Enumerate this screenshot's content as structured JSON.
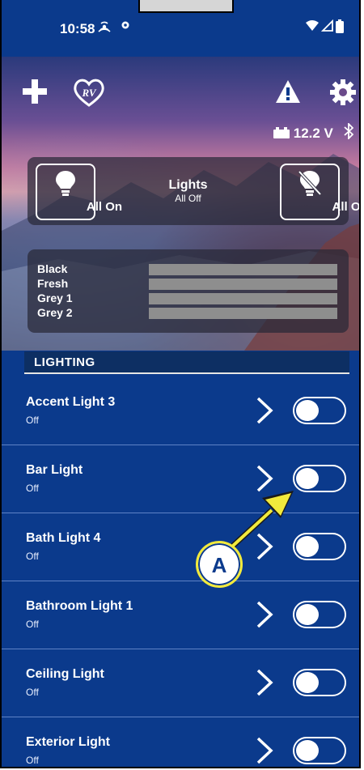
{
  "status_bar": {
    "time": "10:58",
    "icons": [
      "hotspot-icon",
      "settings-dot-icon",
      "wifi-icon",
      "signal-icon",
      "battery-icon"
    ]
  },
  "header": {
    "icons": [
      "plus-icon",
      "rv-heart-logo-icon",
      "warning-icon",
      "settings-gear-icon"
    ],
    "logo_text": "RV",
    "battery_voltage": "12.2 V"
  },
  "lights_panel": {
    "all_on_label": "All On",
    "title": "Lights",
    "subtitle": "All Off",
    "all_off_label": "All Off"
  },
  "tanks": [
    {
      "label": "Black"
    },
    {
      "label": "Fresh"
    },
    {
      "label": "Grey 1"
    },
    {
      "label": "Grey 2"
    }
  ],
  "section": {
    "title": "LIGHTING"
  },
  "lighting_items": [
    {
      "name": "Accent Light 3",
      "status": "Off"
    },
    {
      "name": "Bar Light",
      "status": "Off"
    },
    {
      "name": "Bath Light 4",
      "status": "Off"
    },
    {
      "name": "Bathroom Light 1",
      "status": "Off"
    },
    {
      "name": "Ceiling Light",
      "status": "Off"
    },
    {
      "name": "Exterior Light",
      "status": "Off"
    }
  ],
  "callout": {
    "label": "A",
    "color": "#f2ea3c"
  }
}
